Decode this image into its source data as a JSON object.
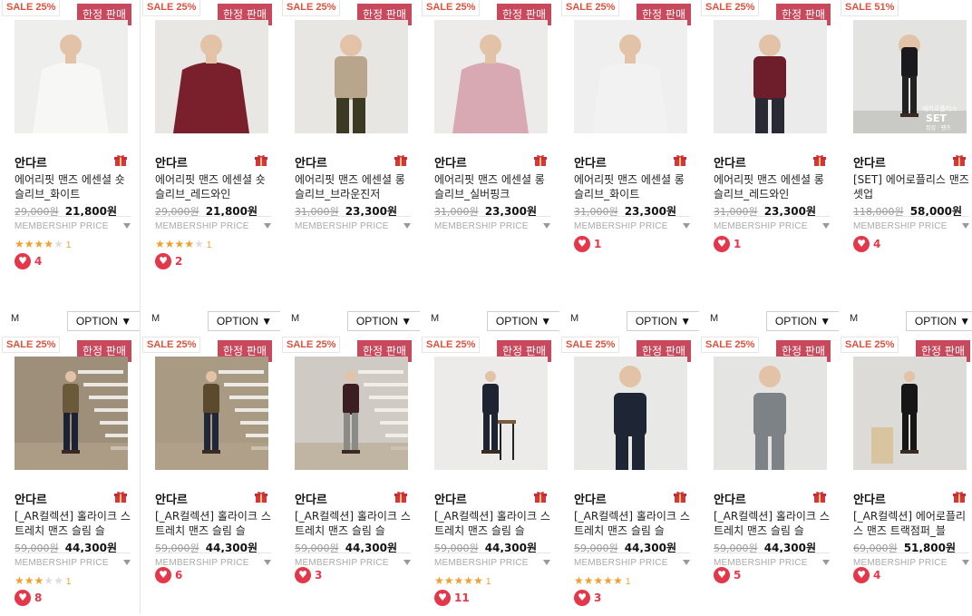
{
  "common": {
    "limited_label": "한정 판매",
    "membership_label": "MEMBERSHIP PRICE",
    "option_label": "OPTION ▼",
    "size_label": "M"
  },
  "colors": {
    "sale": "#e0513d",
    "limited_badge": "#c8485c",
    "heart": "#e4374a",
    "star": "#f0a030"
  },
  "row1": [
    {
      "sale": "SALE 25%",
      "brand": "안다르",
      "name": "에어리핏 맨즈 에센셜 숏슬리브_화이트",
      "old_price": "29,000원",
      "price": "21,800원",
      "rating_stars": 4,
      "rating_count": "1",
      "likes": "4"
    },
    {
      "sale": "SALE 25%",
      "brand": "안다르",
      "name": "에어리핏 맨즈 에센셜 숏슬리브_레드와인",
      "old_price": "29,000원",
      "price": "21,800원",
      "rating_stars": 4,
      "rating_count": "1",
      "likes": "2"
    },
    {
      "sale": "SALE 25%",
      "brand": "안다르",
      "name": "에어리핏 맨즈 에센셜 롱슬리브_브라운진저",
      "old_price": "31,000원",
      "price": "23,300원",
      "rating_stars": null,
      "rating_count": null,
      "likes": null
    },
    {
      "sale": "SALE 25%",
      "brand": "안다르",
      "name": "에어리핏 맨즈 에센셜 롱슬리브_실버핑크",
      "old_price": "31,000원",
      "price": "23,300원",
      "rating_stars": null,
      "rating_count": null,
      "likes": null
    },
    {
      "sale": "SALE 25%",
      "brand": "안다르",
      "name": "에어리핏 맨즈 에센셜 롱슬리브_화이트",
      "old_price": "31,000원",
      "price": "23,300원",
      "rating_stars": null,
      "rating_count": null,
      "likes": "1"
    },
    {
      "sale": "SALE 25%",
      "brand": "안다르",
      "name": "에어리핏 맨즈 에센셜 롱슬리브_레드와인",
      "old_price": "31,000원",
      "price": "23,300원",
      "rating_stars": null,
      "rating_count": null,
      "likes": "1"
    },
    {
      "sale": "SALE 51%",
      "brand": "안다르",
      "name": "[SET] 에어로플리스 맨즈 셋업",
      "old_price": "118,000원",
      "price": "58,000원",
      "rating_stars": null,
      "rating_count": null,
      "likes": "4",
      "no_limited": true,
      "photo_caption_1": "에어로플리스",
      "photo_caption_2": "SET",
      "photo_caption_3": "집업 · 팬츠"
    }
  ],
  "row2": [
    {
      "sale": "SALE 25%",
      "brand": "안다르",
      "name": "[_AR컬렉션] 홀라이크 스트레치 맨즈 슬림 슬",
      "old_price": "59,000원",
      "price": "44,300원",
      "rating_stars": 3,
      "rating_count": "1",
      "likes": "8"
    },
    {
      "sale": "SALE 25%",
      "brand": "안다르",
      "name": "[_AR컬렉션] 홀라이크 스트레치 맨즈 슬림 슬",
      "old_price": "59,000원",
      "price": "44,300원",
      "rating_stars": null,
      "rating_count": null,
      "likes": "6"
    },
    {
      "sale": "SALE 25%",
      "brand": "안다르",
      "name": "[_AR컬렉션] 홀라이크 스트레치 맨즈 슬림 슬",
      "old_price": "59,000원",
      "price": "44,300원",
      "rating_stars": null,
      "rating_count": null,
      "likes": "3"
    },
    {
      "sale": "SALE 25%",
      "brand": "안다르",
      "name": "[_AR컬렉션] 홀라이크 스트레치 맨즈 슬림 슬",
      "old_price": "59,000원",
      "price": "44,300원",
      "rating_stars": 5,
      "rating_count": "1",
      "likes": "11"
    },
    {
      "sale": "SALE 25%",
      "brand": "안다르",
      "name": "[_AR컬렉션] 홀라이크 스트레치 맨즈 슬림 슬",
      "old_price": "59,000원",
      "price": "44,300원",
      "rating_stars": 5,
      "rating_count": "1",
      "likes": "3"
    },
    {
      "sale": "SALE 25%",
      "brand": "안다르",
      "name": "[_AR컬렉션] 홀라이크 스트레치 맨즈 슬림 슬",
      "old_price": "59,000원",
      "price": "44,300원",
      "rating_stars": null,
      "rating_count": null,
      "likes": "5"
    },
    {
      "sale": "SALE 25%",
      "brand": "안다르",
      "name": "[_AR컬렉션] 에어로플리스 맨즈 트랙점퍼_블",
      "old_price": "69,000원",
      "price": "51,800원",
      "rating_stars": null,
      "rating_count": null,
      "likes": "4"
    }
  ]
}
